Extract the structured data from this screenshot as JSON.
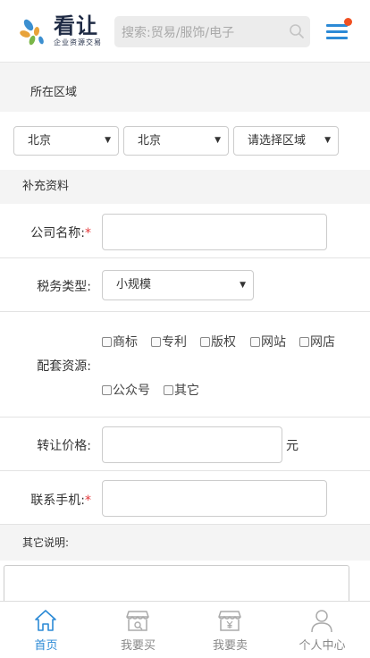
{
  "header": {
    "logo_name": "看让",
    "logo_sub": "企业资源交易",
    "search_placeholder": "搜索:贸易/服饰/电子"
  },
  "region": {
    "title": "所在区域",
    "province": "北京",
    "city": "北京",
    "district": "请选择区域"
  },
  "extra": {
    "title": "补充资料",
    "company_label": "公司名称:",
    "tax_label": "税务类型:",
    "tax_value": "小规模",
    "resources_label": "配套资源:",
    "resources": [
      "商标",
      "专利",
      "版权",
      "网站",
      "网店",
      "公众号",
      "其它"
    ],
    "price_label": "转让价格:",
    "price_unit": "元",
    "phone_label": "联系手机:",
    "required_mark": "*"
  },
  "other": {
    "title": "其它说明:"
  },
  "tabbar": {
    "items": [
      {
        "label": "首页",
        "icon": "home-icon",
        "active": true
      },
      {
        "label": "我要买",
        "icon": "shop-search-icon",
        "active": false
      },
      {
        "label": "我要卖",
        "icon": "shop-yen-icon",
        "active": false
      },
      {
        "label": "个人中心",
        "icon": "user-icon",
        "active": false
      }
    ]
  },
  "colors": {
    "accent": "#2c8ad6",
    "required": "#e4393c",
    "notification_dot": "#f05022"
  }
}
